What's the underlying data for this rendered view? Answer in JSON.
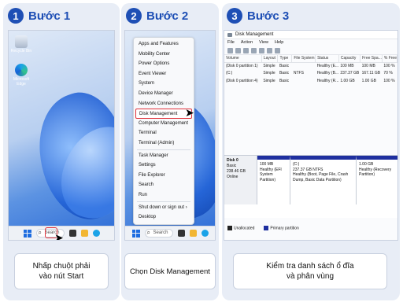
{
  "steps": [
    {
      "number": "1",
      "title": "Bước 1",
      "caption_line1": "Nhấp chuột phải",
      "caption_line2": "vào nút Start",
      "desktop_icons": [
        "Recycle Bin",
        "Microsoft Edge"
      ],
      "taskbar_search": "Search"
    },
    {
      "number": "2",
      "title": "Bước 2",
      "caption": "Chọn Disk Management",
      "menu_items": [
        "Apps and Features",
        "Mobility Center",
        "Power Options",
        "Event Viewer",
        "System",
        "Device Manager",
        "Network Connections",
        "Disk Management",
        "Computer Management",
        "Terminal",
        "Terminal (Admin)",
        "Task Manager",
        "Settings",
        "File Explorer",
        "Search",
        "Run",
        "Shut down or sign out",
        "Desktop"
      ],
      "selected_item": "Disk Management",
      "taskbar_search": "Search"
    },
    {
      "number": "3",
      "title": "Bước 3",
      "caption_line1": "Kiểm tra danh sách ổ đĩa",
      "caption_line2": "và phân vùng",
      "window_title": "Disk Management",
      "menubar": [
        "File",
        "Action",
        "View",
        "Help"
      ],
      "columns": [
        "Volume",
        "Layout",
        "Type",
        "File System",
        "Status",
        "Capacity",
        "Free Spa...",
        "% Free"
      ],
      "rows": [
        [
          "(Disk 0 partition 1)",
          "Simple",
          "Basic",
          "",
          "Healthy (E...",
          "100 MB",
          "100 MB",
          "100 %"
        ],
        [
          "(C:)",
          "Simple",
          "Basic",
          "NTFS",
          "Healthy (B...",
          "237.37 GB",
          "167.11 GB",
          "70 %"
        ],
        [
          "(Disk 0 partition 4)",
          "Simple",
          "Basic",
          "",
          "Healthy (R...",
          "1.00 GB",
          "1.00 GB",
          "100 %"
        ]
      ],
      "disk": {
        "name": "Disk 0",
        "type": "Basic",
        "size": "238.46 GB",
        "state": "Online"
      },
      "partitions": [
        {
          "line1": "100 MB",
          "line2": "Healthy (EFI",
          "line3": "System Partition)",
          "line4": ""
        },
        {
          "line1": "(C:)",
          "line2": "237.37 GB NTFS",
          "line3": "Healthy (Boot, Page File, Crash",
          "line4": "Dump, Basic Data Partition)"
        },
        {
          "line1": "1.00 GB",
          "line2": "Healthy (Recovery",
          "line3": "Partition)",
          "line4": ""
        }
      ],
      "legend": [
        "Unallocated",
        "Primary partition"
      ]
    }
  ],
  "colors": {
    "accent": "#1e4fb5",
    "highlight": "#e0323b",
    "panel_bg": "#e8edf6",
    "partition_bar": "#1e2f9f"
  }
}
